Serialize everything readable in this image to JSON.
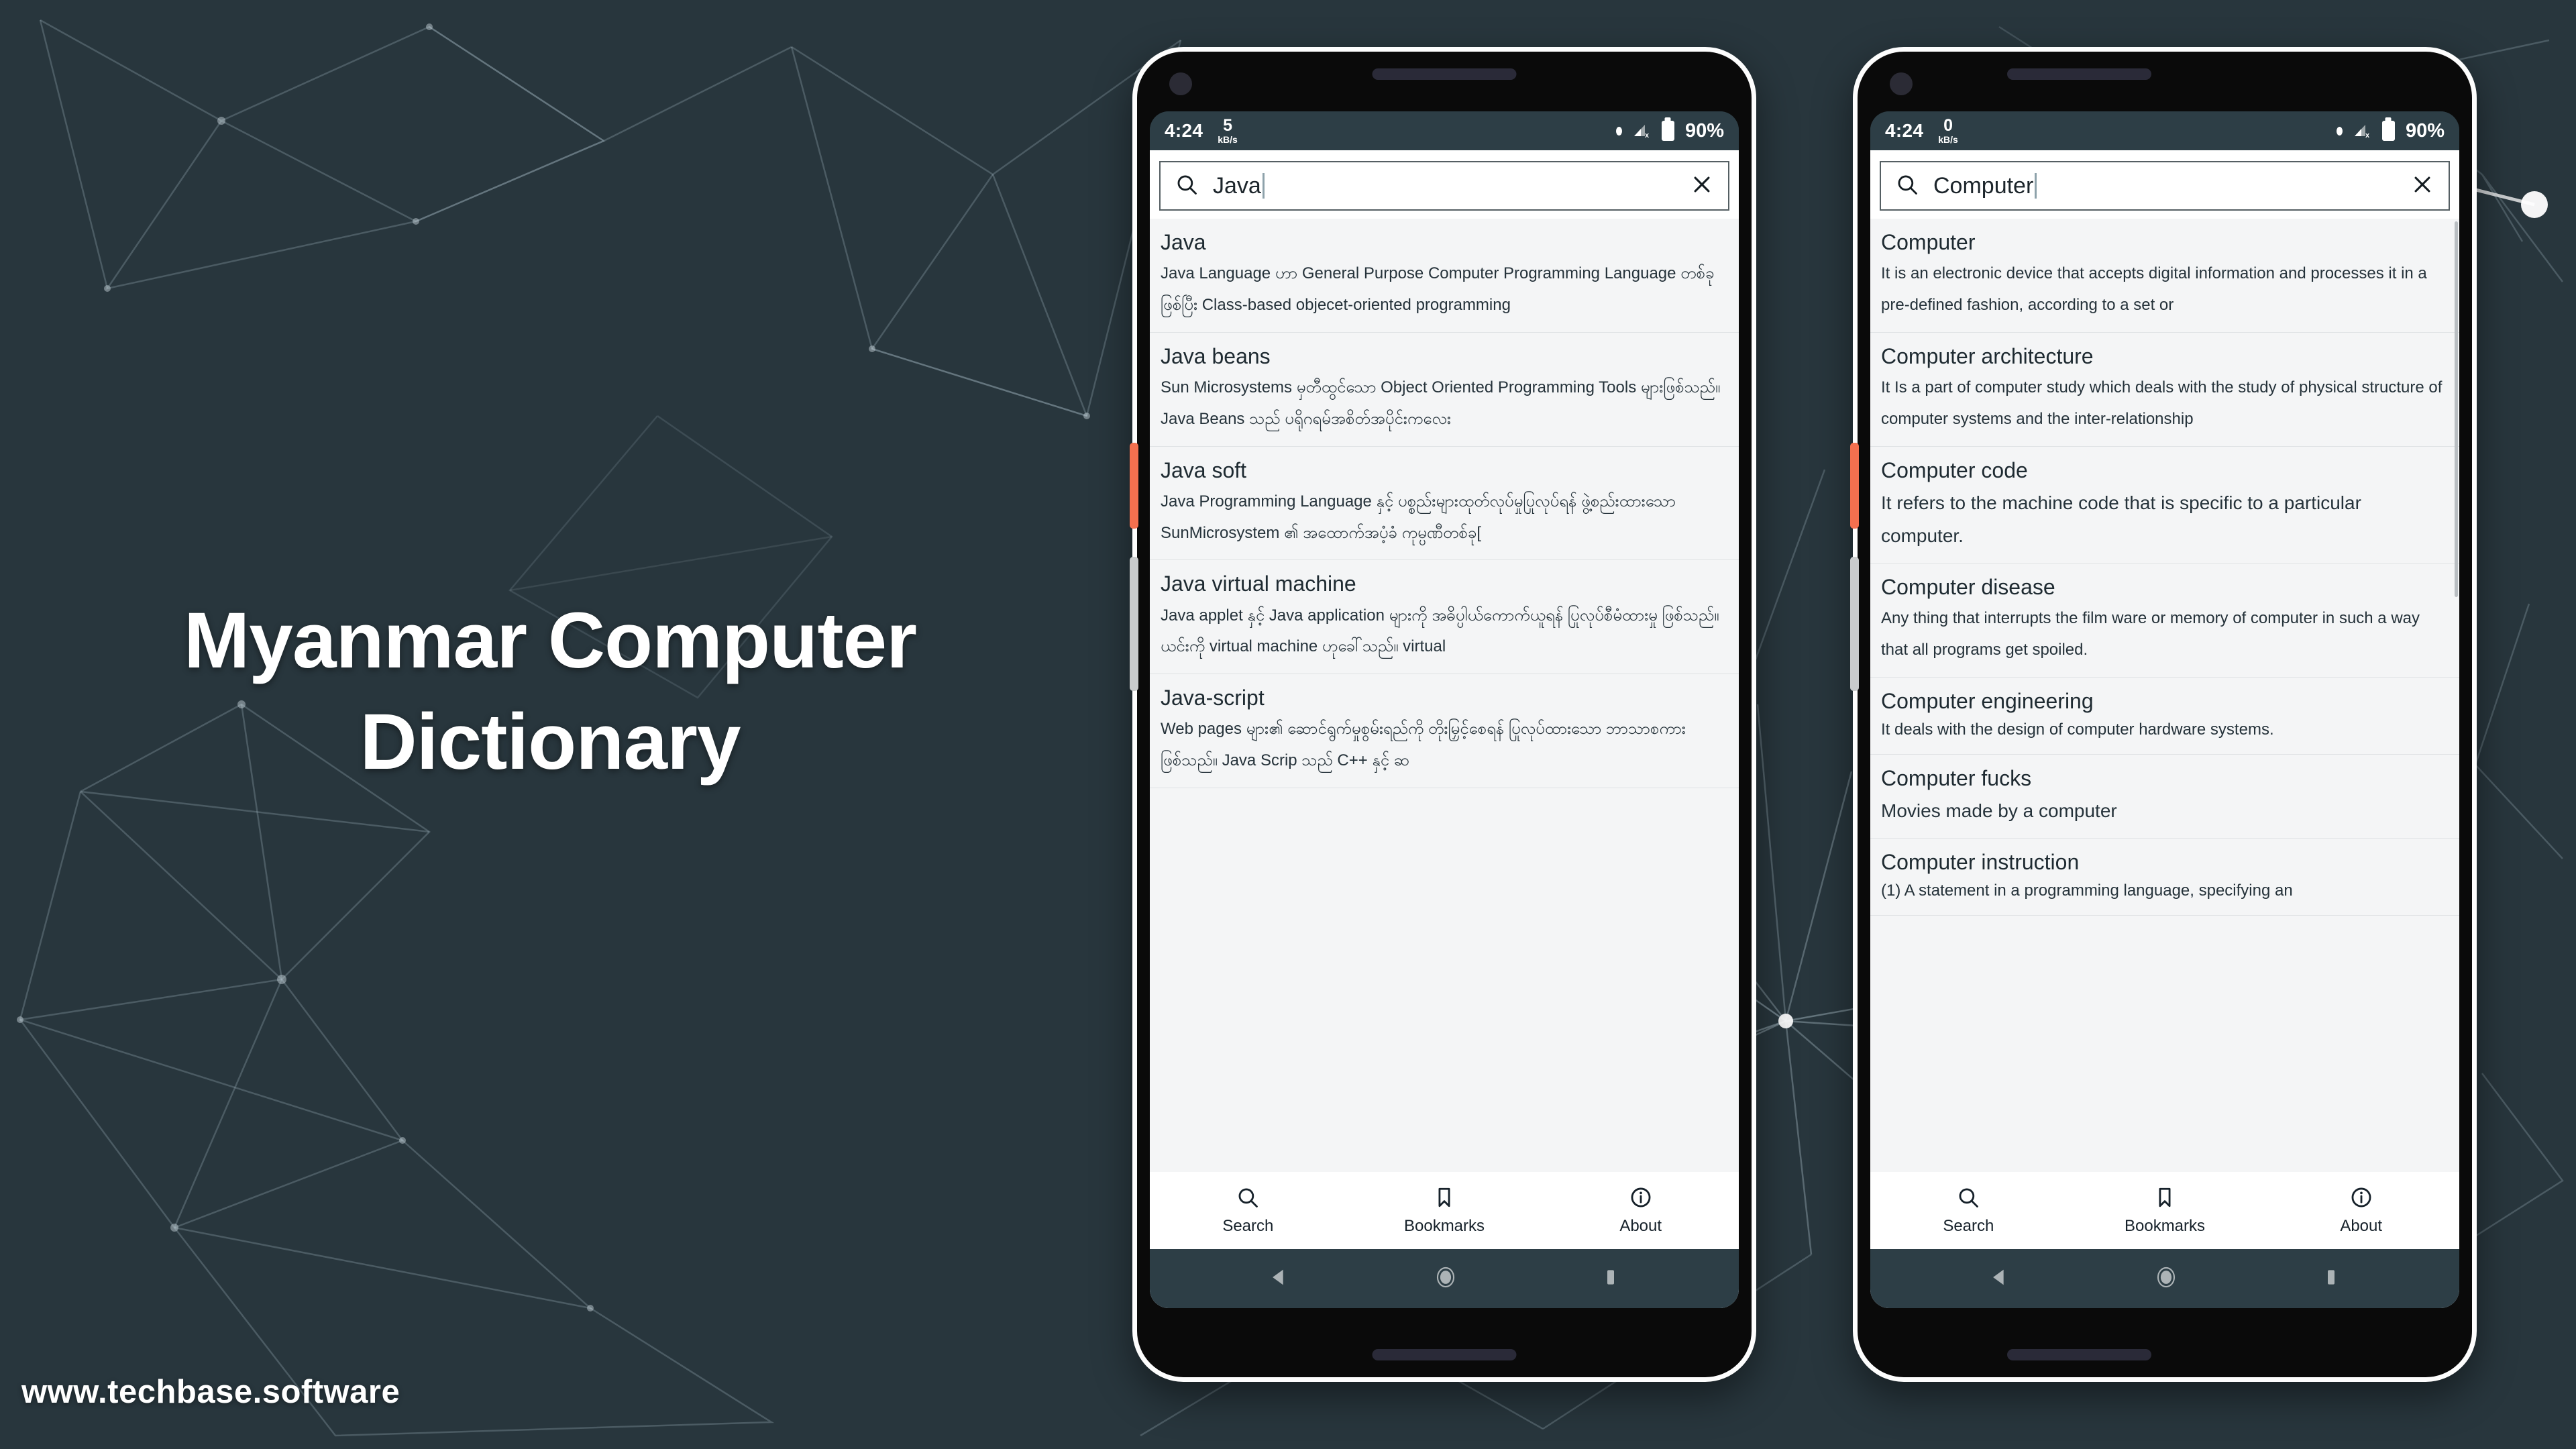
{
  "promo": {
    "title": "Myanmar Computer Dictionary",
    "url": "www.techbase.software",
    "background_color": "#28363d",
    "accent_color": "#f4704f"
  },
  "phones": [
    {
      "id": "phone-left",
      "statusbar": {
        "time": "4:24",
        "data_rate_value": "5",
        "data_rate_unit": "kB/s",
        "battery_percent": "90%",
        "signal_icon": "signal-no-service-icon",
        "battery_icon": "battery-icon",
        "indicator_icon": "dot-indicator-icon"
      },
      "search": {
        "value": "Java",
        "placeholder": "Search",
        "search_icon": "search-icon",
        "clear_icon": "close-icon"
      },
      "results": [
        {
          "term": "Java",
          "definition": "Java Language ဟာ General Purpose Computer Programming Language တစ်ခုဖြစ်ပြီး Class-based objecet-oriented programming"
        },
        {
          "term": "Java beans",
          "definition": "Sun Microsystems မှတီထွင်သော Object Oriented Programming Tools များဖြစ်သည်။ Java Beans သည် ပရိုဂရမ်အစိတ်အပိုင်းကလေး"
        },
        {
          "term": "Java soft",
          "definition": "Java Programming Language နှင့် ပစ္စည်းများထုတ်လုပ်မှုပြုလုပ်ရန် ဖွဲ့စည်းထားသော SunMicrosystem ၏ အထောက်အပံ့ခံ ကုမ္ပဏီတစ်ခု["
        },
        {
          "term": "Java virtual machine",
          "definition": "Java applet နှင့် Java application များကို အဓိပ္ပါယ်ကောက်ယူရန် ပြုလုပ်စီမံထားမှု ဖြစ်သည်။ ယင်းကို virtual machine ဟုခေါ်သည်။ virtual"
        },
        {
          "term": "Java-script",
          "definition": "Web pages များ၏ ဆောင်ရွက်မှုစွမ်းရည်ကို တိုးမြှင့်စေရန် ပြုလုပ်ထားသော ဘာသာစကားဖြစ်သည်။ Java Scrip သည် C++ နှင့် ဆ"
        }
      ],
      "bottom_nav": [
        {
          "label": "Search",
          "icon": "search-icon"
        },
        {
          "label": "Bookmarks",
          "icon": "bookmark-icon"
        },
        {
          "label": "About",
          "icon": "info-icon"
        }
      ],
      "system_nav": [
        {
          "icon": "back-triangle-icon"
        },
        {
          "icon": "home-circle-icon"
        },
        {
          "icon": "recents-square-icon"
        }
      ]
    },
    {
      "id": "phone-right",
      "statusbar": {
        "time": "4:24",
        "data_rate_value": "0",
        "data_rate_unit": "kB/s",
        "battery_percent": "90%",
        "signal_icon": "signal-no-service-icon",
        "battery_icon": "battery-icon",
        "indicator_icon": "dot-indicator-icon"
      },
      "search": {
        "value": "Computer",
        "placeholder": "Search",
        "search_icon": "search-icon",
        "clear_icon": "close-icon"
      },
      "results": [
        {
          "term": "Computer",
          "definition": "It is an electronic device that accepts digital information and processes it in a pre-defined fashion, according to a set or"
        },
        {
          "term": "Computer architecture",
          "definition": "It Is a part of computer study which deals with the study of physical structure of computer systems and the inter-relationship"
        },
        {
          "term": "Computer code",
          "definition": "It refers to the machine code that is specific to a particular computer."
        },
        {
          "term": "Computer disease",
          "definition": "Any thing that interrupts the film ware or memory of computer in such a way that all programs get spoiled."
        },
        {
          "term": "Computer engineering",
          "definition": "It deals with the design of computer hardware systems."
        },
        {
          "term": "Computer fucks",
          "definition": "Movies made by a computer"
        },
        {
          "term": "Computer instruction",
          "definition": "(1) A statement in a programming language, specifying an"
        }
      ],
      "bottom_nav": [
        {
          "label": "Search",
          "icon": "search-icon"
        },
        {
          "label": "Bookmarks",
          "icon": "bookmark-icon"
        },
        {
          "label": "About",
          "icon": "info-icon"
        }
      ],
      "system_nav": [
        {
          "icon": "back-triangle-icon"
        },
        {
          "icon": "home-circle-icon"
        },
        {
          "icon": "recents-square-icon"
        }
      ]
    }
  ]
}
